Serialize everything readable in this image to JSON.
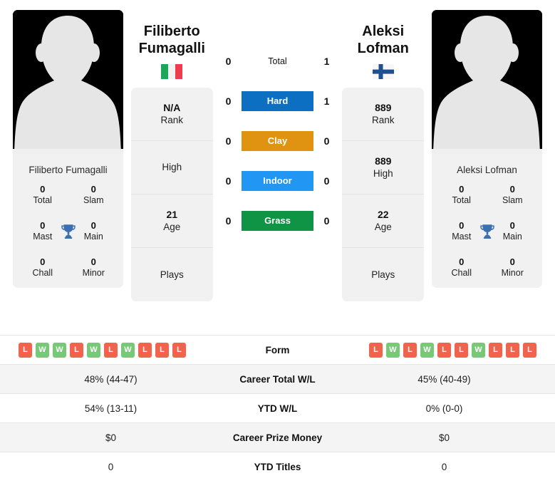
{
  "players": {
    "left": {
      "first_name": "Filiberto",
      "last_name": "Fumagalli",
      "full_name": "Filiberto Fumagalli",
      "country": "Italy",
      "flag_icon": "flag-italy-icon",
      "avatar_icon": "player-photo-placeholder-icon",
      "rank_card": [
        {
          "value": "N/A",
          "label": "Rank"
        },
        {
          "value": "",
          "label": "High"
        },
        {
          "value": "21",
          "label": "Age"
        },
        {
          "value": "",
          "label": "Plays"
        }
      ],
      "titles": [
        {
          "value": "0",
          "label": "Total"
        },
        {
          "value": "0",
          "label": "Slam"
        },
        {
          "value": "0",
          "label": "Mast"
        },
        {
          "value": "0",
          "label": "Main"
        },
        {
          "value": "0",
          "label": "Chall"
        },
        {
          "value": "0",
          "label": "Minor"
        }
      ],
      "form": [
        "L",
        "W",
        "W",
        "L",
        "W",
        "L",
        "W",
        "L",
        "L",
        "L"
      ],
      "career_total_wl": "48% (44-47)",
      "ytd_wl": "54% (13-11)",
      "career_prize_money": "$0",
      "ytd_titles": "0"
    },
    "right": {
      "first_name": "Aleksi",
      "last_name": "Lofman",
      "full_name": "Aleksi Lofman",
      "country": "Finland",
      "flag_icon": "flag-finland-icon",
      "avatar_icon": "player-photo-placeholder-icon",
      "rank_card": [
        {
          "value": "889",
          "label": "Rank"
        },
        {
          "value": "889",
          "label": "High"
        },
        {
          "value": "22",
          "label": "Age"
        },
        {
          "value": "",
          "label": "Plays"
        }
      ],
      "titles": [
        {
          "value": "0",
          "label": "Total"
        },
        {
          "value": "0",
          "label": "Slam"
        },
        {
          "value": "0",
          "label": "Mast"
        },
        {
          "value": "0",
          "label": "Main"
        },
        {
          "value": "0",
          "label": "Chall"
        },
        {
          "value": "0",
          "label": "Minor"
        }
      ],
      "form": [
        "L",
        "W",
        "L",
        "W",
        "L",
        "L",
        "W",
        "L",
        "L",
        "L"
      ],
      "career_total_wl": "45% (40-49)",
      "ytd_wl": "0% (0-0)",
      "career_prize_money": "$0",
      "ytd_titles": "0"
    }
  },
  "head_to_head": [
    {
      "label": "Total",
      "left": "0",
      "right": "1",
      "color": ""
    },
    {
      "label": "Hard",
      "left": "0",
      "right": "1",
      "color": "#0c6fc2"
    },
    {
      "label": "Clay",
      "left": "0",
      "right": "0",
      "color": "#e09211"
    },
    {
      "label": "Indoor",
      "left": "0",
      "right": "0",
      "color": "#2196f3"
    },
    {
      "label": "Grass",
      "left": "0",
      "right": "0",
      "color": "#0e9444"
    }
  ],
  "comparison_rows": [
    {
      "key": "form",
      "label": "Form",
      "type": "form"
    },
    {
      "key": "career_total_wl",
      "label": "Career Total W/L",
      "type": "text"
    },
    {
      "key": "ytd_wl",
      "label": "YTD W/L",
      "type": "text"
    },
    {
      "key": "career_prize_money",
      "label": "Career Prize Money",
      "type": "text"
    },
    {
      "key": "ytd_titles",
      "label": "YTD Titles",
      "type": "text"
    }
  ],
  "colors": {
    "win_badge": "#78c878",
    "loss_badge": "#f0634c",
    "card_background": "#f1f1f1",
    "trophy": "#3b6fb0"
  }
}
